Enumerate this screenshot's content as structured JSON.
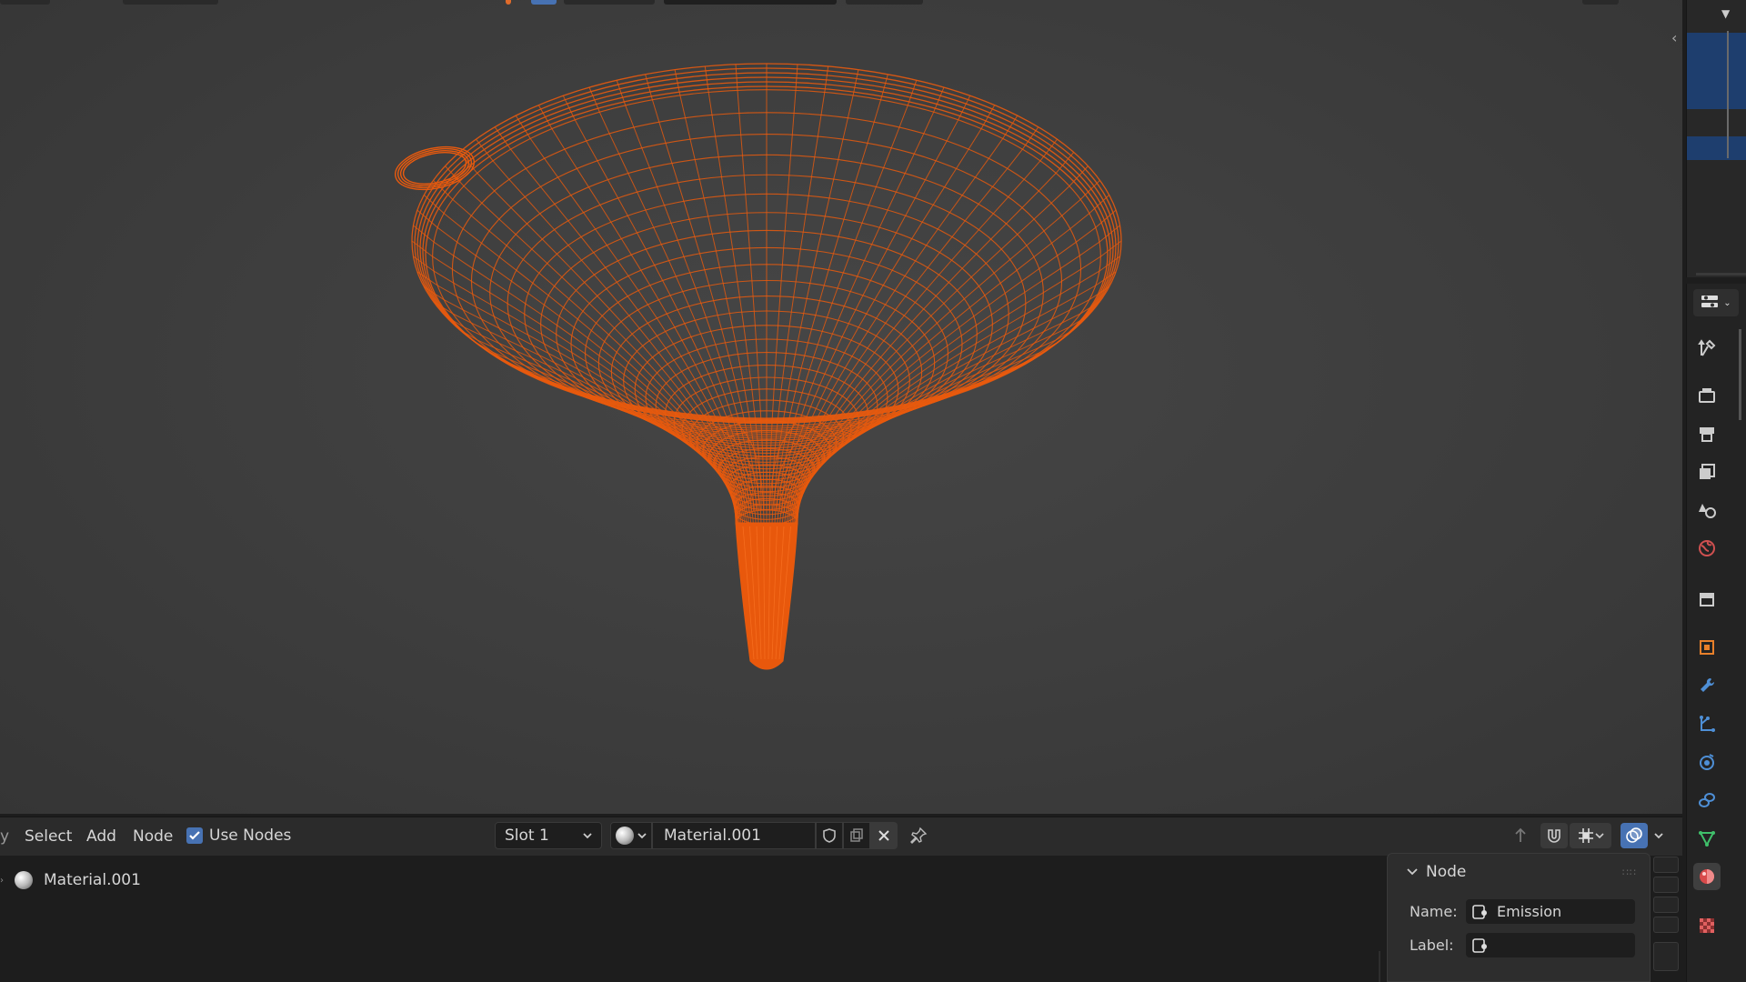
{
  "viewport": {
    "name": "3D Viewport",
    "object": "funnel wireframe",
    "wire_color": "#e85a0e",
    "background_color": "#3d3d3d"
  },
  "node_editor": {
    "menu": {
      "select": "Select",
      "add": "Add",
      "node": "Node"
    },
    "use_nodes": {
      "label": "Use Nodes",
      "checked": true
    },
    "slot": "Slot 1",
    "material": "Material.001",
    "breadcrumb": "Material.001"
  },
  "node_panel": {
    "title": "Node",
    "name_label": "Name:",
    "name_value": "Emission",
    "label_label": "Label:",
    "label_value": ""
  },
  "properties_tabs": [
    "tool",
    "render",
    "output",
    "view-layer",
    "scene",
    "world",
    "collection",
    "object",
    "modifiers",
    "particles",
    "physics",
    "constraints",
    "data",
    "material",
    "texture"
  ],
  "active_properties_tab": "material",
  "colors": {
    "accent": "#4772b3",
    "wire": "#e85a0e"
  }
}
